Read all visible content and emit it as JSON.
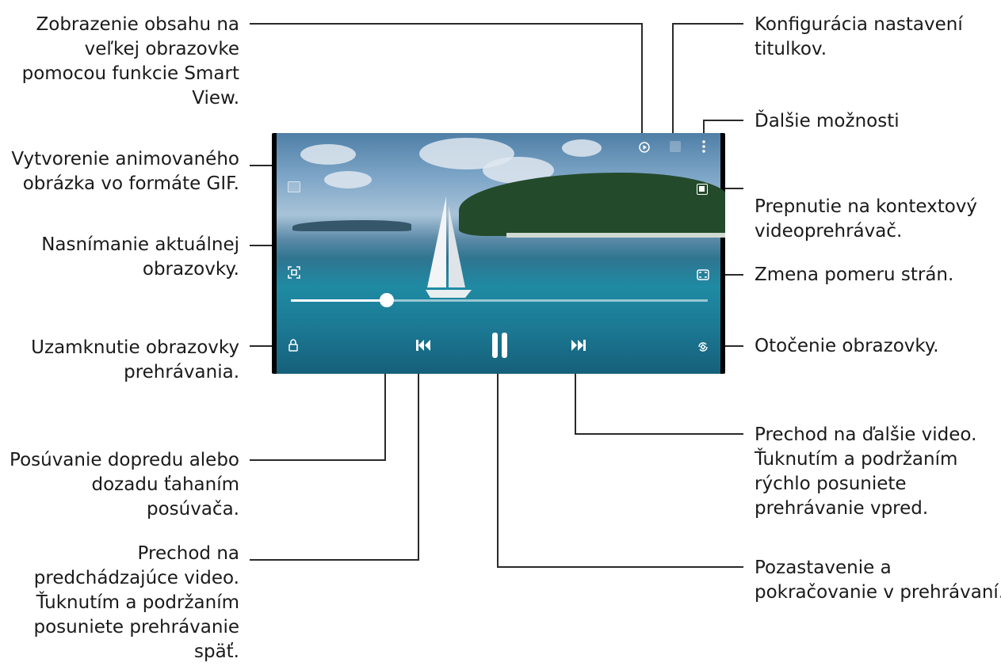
{
  "labels": {
    "smart_view": [
      "Zobrazenie obsahu na",
      "veľkej obrazovke",
      "pomocou funkcie Smart",
      "View."
    ],
    "gif": [
      "Vytvorenie animovaného",
      "obrázka vo formáte GIF."
    ],
    "capture": [
      "Nasnímanie aktuálnej",
      "obrazovky."
    ],
    "lock": [
      "Uzamknutie obrazovky",
      "prehrávania."
    ],
    "seek": [
      "Posúvanie dopredu alebo",
      "dozadu ťahaním",
      "posúvača."
    ],
    "previous": [
      "Prechod na",
      "predchádzajúce video.",
      "Ťuknutím a podržaním",
      "posuniete prehrávanie",
      "späť."
    ],
    "subtitles": [
      "Konfigurácia nastavení",
      "titulkov."
    ],
    "more": [
      "Ďalšie možnosti"
    ],
    "popup": [
      "Prepnutie na kontextový",
      "videoprehrávač."
    ],
    "ratio": [
      "Zmena pomeru strán."
    ],
    "rotate": [
      "Otočenie obrazovky."
    ],
    "next": [
      "Prechod na ďalšie video.",
      "Ťuknutím a podržaním",
      "rýchlo posuniete",
      "prehrávanie vpred."
    ],
    "pause": [
      "Pozastavenie a",
      "pokračovanie v prehrávaní."
    ]
  },
  "player": {
    "progress": 0.23,
    "icons": {
      "smart_view": "smart-view-icon",
      "subtitles": "subtitles-icon",
      "more": "more-options-icon",
      "gif": "gif-icon",
      "popup": "popup-player-icon",
      "capture": "capture-icon",
      "ratio": "aspect-ratio-icon",
      "lock": "lock-icon",
      "rotate": "rotate-icon",
      "previous": "previous-icon",
      "pause": "pause-icon",
      "next": "next-icon"
    }
  },
  "colors": {
    "text": "#1a1a1a",
    "leader": "#2a2a2a",
    "frame": "#000000"
  }
}
